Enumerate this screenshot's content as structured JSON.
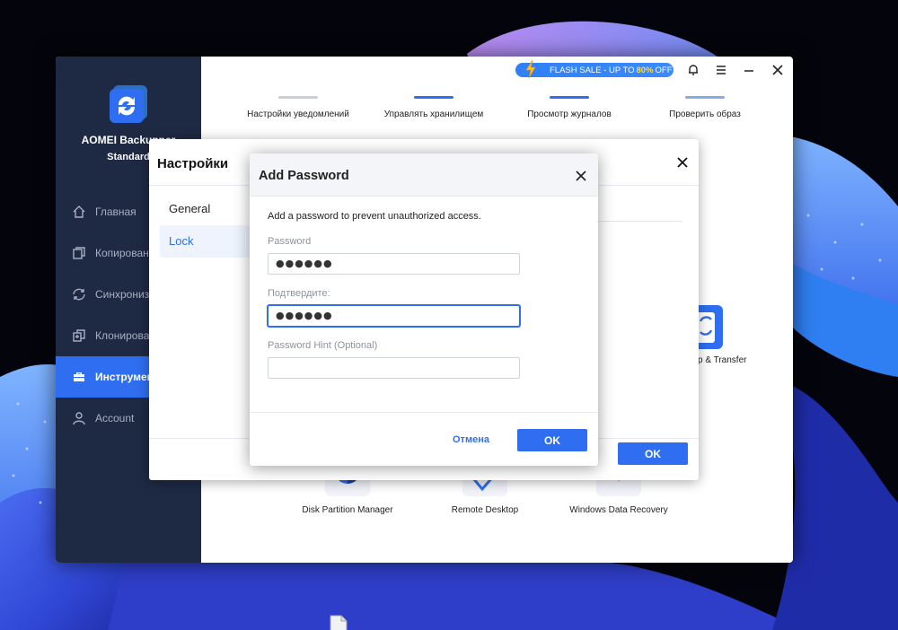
{
  "app": {
    "name": "AOMEI Backupper",
    "edition": "Standard",
    "flash_sale": {
      "prefix": "FLASH SALE - UP TO",
      "highlight": "80%",
      "suffix": "OFF"
    },
    "nav": [
      {
        "label": "Главная",
        "icon": "home-icon"
      },
      {
        "label": "Копирован",
        "icon": "copy-icon"
      },
      {
        "label": "Синхрониз",
        "icon": "sync-icon"
      },
      {
        "label": "Клонирова",
        "icon": "clone-icon"
      },
      {
        "label": "Инструмен",
        "icon": "toolbox-icon",
        "active": true
      },
      {
        "label": "Account",
        "icon": "user-icon"
      }
    ],
    "tools_top": [
      "Настройки уведомлений",
      "Управлять хранилищем",
      "Просмотр журналов",
      "Проверить образ"
    ],
    "tools_bottom": [
      "Disk Partition Manager",
      "Remote Desktop",
      "Windows Data Recovery"
    ],
    "backup_transfer_label": "p & Transfer"
  },
  "settings": {
    "title": "Настройки",
    "nav": [
      "General",
      "Lock"
    ],
    "active_nav": "Lock",
    "ok_label": "OK"
  },
  "password_dialog": {
    "title": "Add Password",
    "description": "Add a password to prevent unauthorized access.",
    "password_label": "Password",
    "password_value": "●●●●●●",
    "confirm_label": "Подтвердите:",
    "confirm_value": "●●●●●●",
    "hint_label": "Password Hint (Optional)",
    "hint_value": "",
    "cancel_label": "Отмена",
    "ok_label": "OK"
  },
  "colors": {
    "accent": "#2f6ef0",
    "sidebar": "#1e2a43",
    "flash_highlight": "#ffd84a"
  }
}
